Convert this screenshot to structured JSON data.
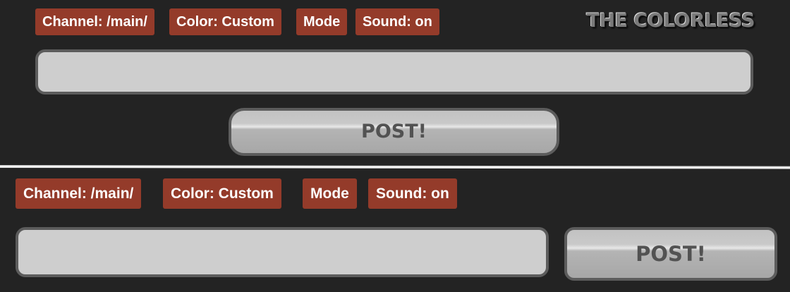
{
  "top_panel": {
    "chips": [
      {
        "label": "Channel: /main/"
      },
      {
        "label": "Color: Custom"
      },
      {
        "label": "Mode"
      },
      {
        "label": "Sound: on"
      }
    ],
    "logo_text": "THE COLORLESS",
    "input_value": "",
    "input_placeholder": "",
    "post_label": "POST!"
  },
  "bottom_panel": {
    "chips": [
      {
        "label": "Channel: /main/"
      },
      {
        "label": "Color: Custom"
      },
      {
        "label": "Mode"
      },
      {
        "label": "Sound: on"
      }
    ],
    "input_value": "",
    "input_placeholder": "",
    "post_label": "POST!"
  },
  "colors": {
    "background": "#232323",
    "chip_background": "#943b2a",
    "chip_text": "#ffffff",
    "input_background": "#cecece",
    "border": "#5c5c5c",
    "post_text": "#525252"
  }
}
